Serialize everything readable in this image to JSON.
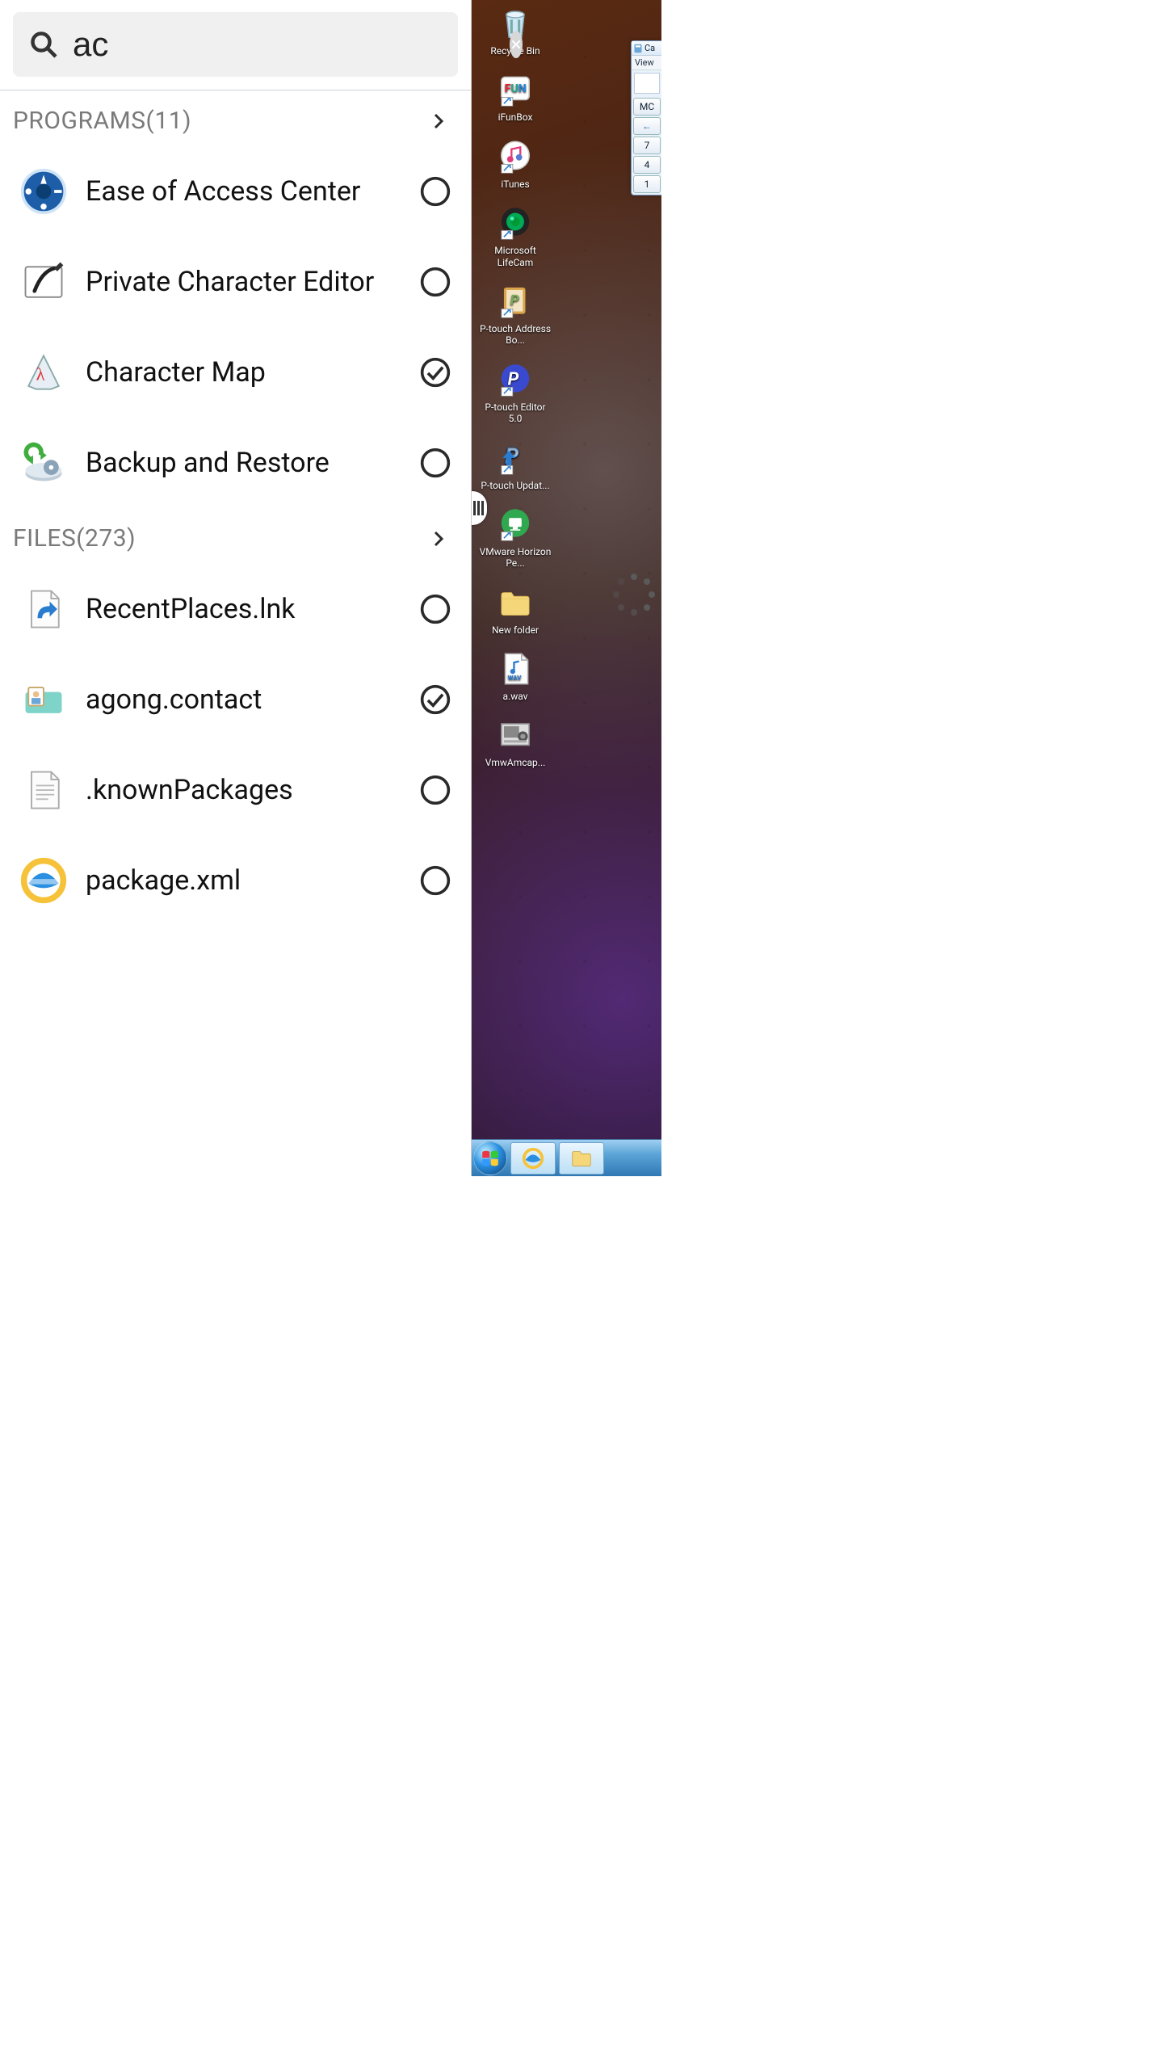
{
  "search": {
    "query": "ac",
    "placeholder": "Search"
  },
  "sections": {
    "programs": {
      "label": "PROGRAMS",
      "count": 11
    },
    "files": {
      "label": "FILES",
      "count": 273
    }
  },
  "programs": [
    {
      "label": "Ease of Access Center",
      "icon": "ease-of-access-icon",
      "checked": false
    },
    {
      "label": "Private Character Editor",
      "icon": "private-char-editor-icon",
      "checked": false
    },
    {
      "label": "Character Map",
      "icon": "character-map-icon",
      "checked": true
    },
    {
      "label": "Backup and Restore",
      "icon": "backup-restore-icon",
      "checked": false
    }
  ],
  "files": [
    {
      "label": "RecentPlaces.lnk",
      "icon": "shortcut-file-icon",
      "checked": false
    },
    {
      "label": "agong.contact",
      "icon": "contact-file-icon",
      "checked": true
    },
    {
      "label": ".knownPackages",
      "icon": "text-file-icon",
      "checked": false
    },
    {
      "label": "package.xml",
      "icon": "ie-xml-icon",
      "checked": false
    }
  ],
  "desktop_icons": [
    {
      "label": "Recycle Bin",
      "icon": "recycle-bin-icon"
    },
    {
      "label": "iFunBox",
      "icon": "ifunbox-icon"
    },
    {
      "label": "iTunes",
      "icon": "itunes-icon"
    },
    {
      "label": "Microsoft LifeCam",
      "icon": "lifecam-icon"
    },
    {
      "label": "P-touch Address Bo...",
      "icon": "ptouch-address-icon"
    },
    {
      "label": "P-touch Editor 5.0",
      "icon": "ptouch-editor-icon"
    },
    {
      "label": "P-touch Updat...",
      "icon": "ptouch-update-icon"
    },
    {
      "label": "VMware Horizon Pe...",
      "icon": "vmware-horizon-icon"
    },
    {
      "label": "New folder",
      "icon": "folder-icon"
    },
    {
      "label": "a.wav",
      "icon": "wav-file-icon"
    },
    {
      "label": "VmwAmcap...",
      "icon": "vmwamcap-icon"
    }
  ],
  "calculator": {
    "title": "Ca",
    "menu": "View",
    "keys": [
      "MC",
      "←",
      "7",
      "4",
      "1"
    ]
  },
  "taskbar": {
    "start": "Start",
    "pinned": [
      "internet-explorer-icon",
      "file-explorer-icon"
    ]
  }
}
